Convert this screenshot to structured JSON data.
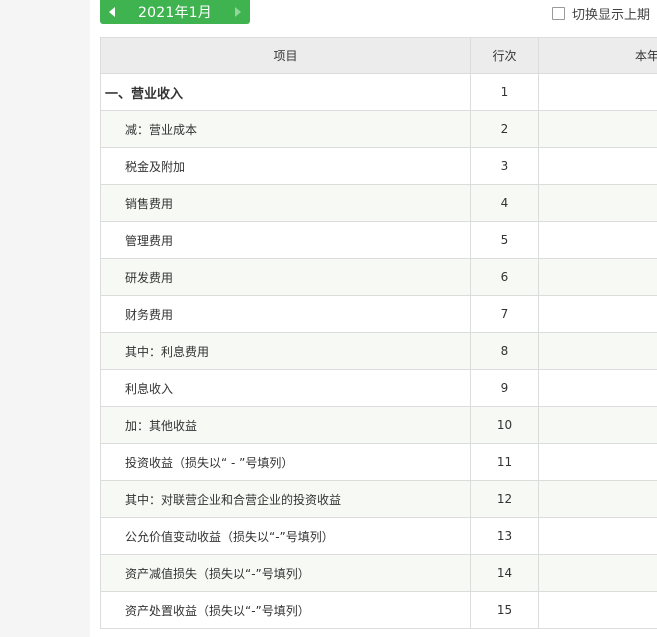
{
  "period": {
    "label": "2021年1月"
  },
  "toggle": {
    "label": "切换显示上期"
  },
  "table": {
    "headers": {
      "item": "项目",
      "row": "行次",
      "current": "本年"
    },
    "rows": [
      {
        "item": "一、营业收入",
        "row": "1",
        "bold": true
      },
      {
        "item": "减：营业成本",
        "row": "2"
      },
      {
        "item": "税金及附加",
        "row": "3"
      },
      {
        "item": "销售费用",
        "row": "4"
      },
      {
        "item": "管理费用",
        "row": "5"
      },
      {
        "item": "研发费用",
        "row": "6"
      },
      {
        "item": "财务费用",
        "row": "7"
      },
      {
        "item": "其中：利息费用",
        "row": "8"
      },
      {
        "item": "利息收入",
        "row": "9"
      },
      {
        "item": "加：其他收益",
        "row": "10"
      },
      {
        "item": "投资收益（损失以“ - ”号填列）",
        "row": "11"
      },
      {
        "item": "其中：对联营企业和合营企业的投资收益",
        "row": "12"
      },
      {
        "item": "公允价值变动收益（损失以“-”号填列）",
        "row": "13"
      },
      {
        "item": "资产减值损失（损失以“-”号填列）",
        "row": "14"
      },
      {
        "item": "资产处置收益（损失以“-”号填列）",
        "row": "15"
      }
    ]
  },
  "colors": {
    "accent": "#3fb34f",
    "header_bg": "#ececec",
    "alt_row_bg": "#f7f9f5"
  }
}
